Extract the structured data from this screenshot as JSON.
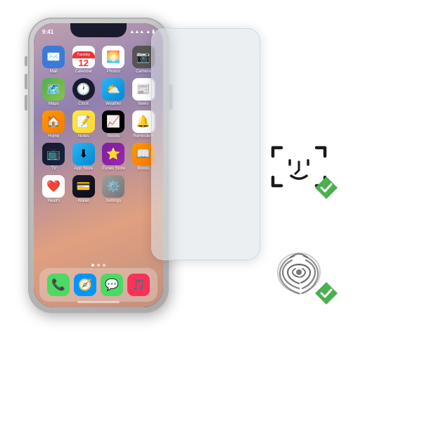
{
  "scene": {
    "title": "iPhone X with screen protector showing Face ID and Touch ID compatibility"
  },
  "iphone": {
    "status": {
      "time": "9:41",
      "signal": "●●●",
      "wifi": "WiFi",
      "battery": "█"
    },
    "apps": [
      {
        "name": "Mail",
        "emoji": "✉️",
        "bg": "mail-bg"
      },
      {
        "name": "Calendar",
        "emoji": "📅",
        "bg": "calendar-bg",
        "date": "12"
      },
      {
        "name": "Photos",
        "emoji": "🌅",
        "bg": "photos-bg"
      },
      {
        "name": "Camera",
        "emoji": "📷",
        "bg": "camera-bg"
      },
      {
        "name": "Maps",
        "emoji": "🗺️",
        "bg": "maps-bg"
      },
      {
        "name": "Clock",
        "emoji": "🕐",
        "bg": "clock-bg"
      },
      {
        "name": "Weather",
        "emoji": "⛅",
        "bg": "weather-bg"
      },
      {
        "name": "News",
        "emoji": "📰",
        "bg": "news-bg"
      },
      {
        "name": "Home",
        "emoji": "🏠",
        "bg": "home-bg"
      },
      {
        "name": "Notes",
        "emoji": "📝",
        "bg": "notes-bg"
      },
      {
        "name": "Stocks",
        "emoji": "📈",
        "bg": "stocks-bg"
      },
      {
        "name": "Reminders",
        "emoji": "🔔",
        "bg": "reminders-bg"
      },
      {
        "name": "TV",
        "emoji": "📺",
        "bg": "tv-bg"
      },
      {
        "name": "App Store",
        "emoji": "⬇",
        "bg": "appstore-bg"
      },
      {
        "name": "iTunes Store",
        "emoji": "⭐",
        "bg": "itunes-bg"
      },
      {
        "name": "iBooks",
        "emoji": "📖",
        "bg": "ibooks-bg"
      },
      {
        "name": "Health",
        "emoji": "❤️",
        "bg": "health-bg"
      },
      {
        "name": "Wallet",
        "emoji": "💳",
        "bg": "wallet-bg"
      },
      {
        "name": "Settings",
        "emoji": "⚙️",
        "bg": "settings-bg"
      }
    ],
    "dock": [
      {
        "name": "Phone",
        "emoji": "📞",
        "bg": "green"
      },
      {
        "name": "Safari",
        "emoji": "🧭",
        "bg": "#0096ff"
      },
      {
        "name": "Messages",
        "emoji": "💬",
        "bg": "#4cd964"
      },
      {
        "name": "Music",
        "emoji": "🎵",
        "bg": "#fc3158"
      }
    ]
  },
  "features": {
    "face_id": {
      "label": "Face ID",
      "check": true
    },
    "fingerprint": {
      "label": "Fingerprint",
      "check": true
    }
  },
  "colors": {
    "check_green": "#4CAF50",
    "face_id_dark": "#1a1a1a",
    "glass_bg": "rgba(220,225,230,0.55)"
  }
}
